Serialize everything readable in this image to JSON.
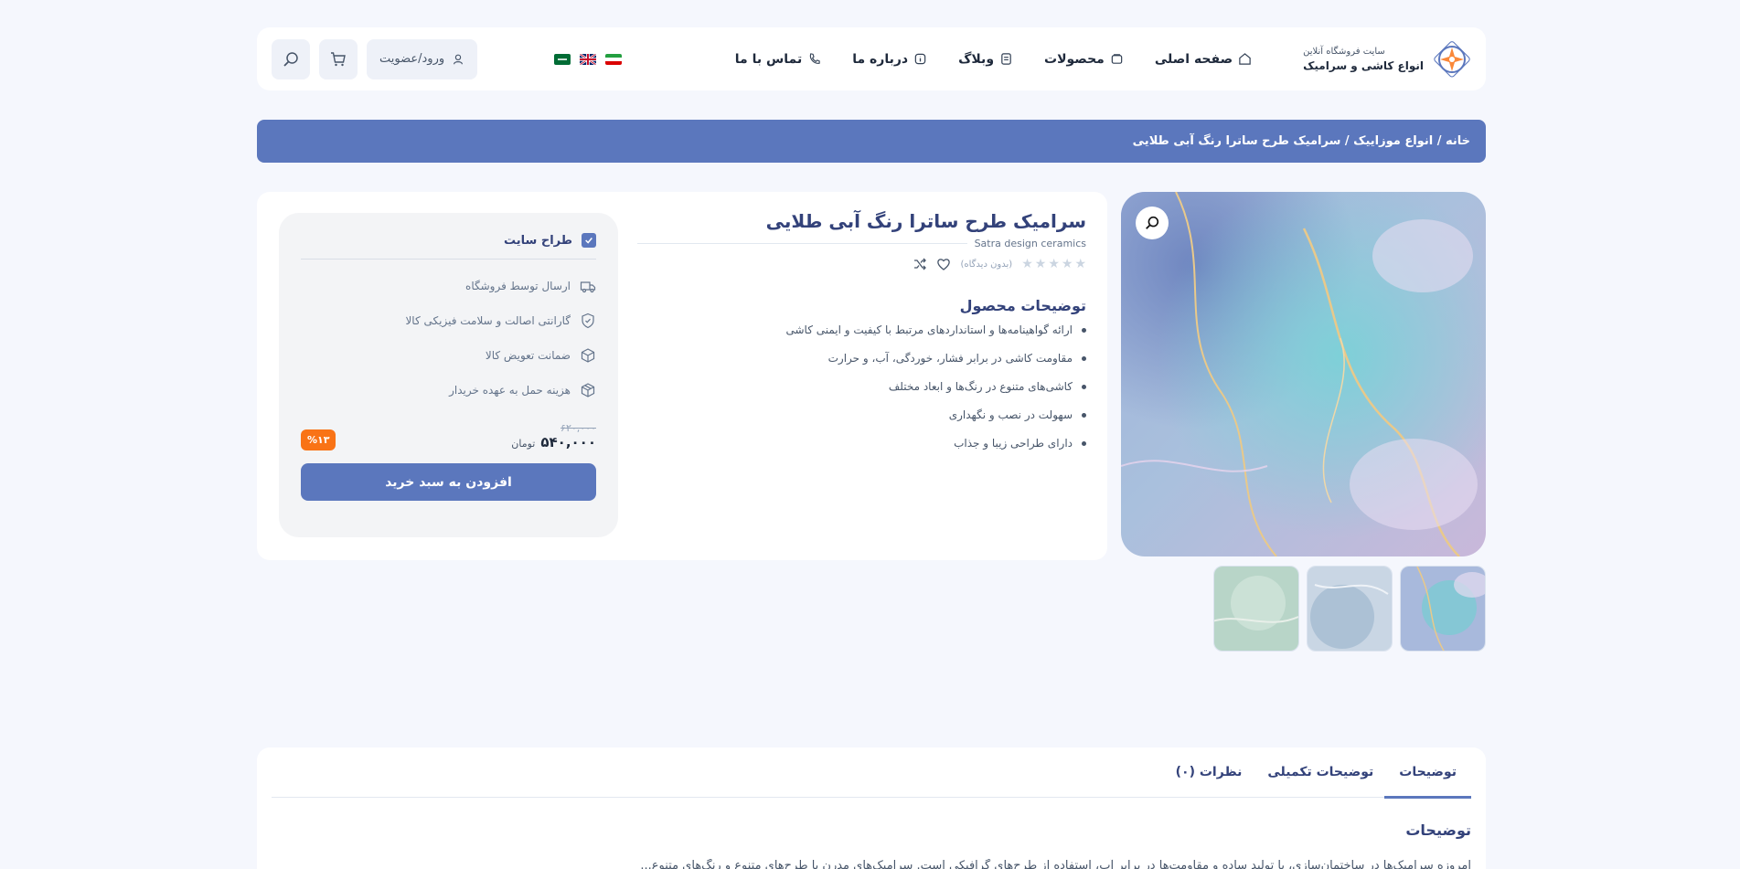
{
  "header": {
    "logo_small": "سایت فروشگاه آنلاین",
    "logo_big": "انواع کاشی و سرامیک",
    "nav": [
      {
        "label": "صفحه اصلی",
        "icon": "home-icon"
      },
      {
        "label": "محصولات",
        "icon": "products-icon"
      },
      {
        "label": "وبلاگ",
        "icon": "blog-icon"
      },
      {
        "label": "درباره ما",
        "icon": "info-icon"
      },
      {
        "label": "تماس با ما",
        "icon": "phone-icon"
      }
    ],
    "flags": [
      "flag-iran",
      "flag-uk",
      "flag-saudi"
    ],
    "login_label": "ورود/عضویت",
    "cart_icon": "cart-icon",
    "search_icon": "search-icon"
  },
  "breadcrumb": {
    "text": "خانه / انواع موزاییک / سرامیک طرح ساترا رنگ آبی طلایی"
  },
  "product": {
    "title": "سرامیک طرح ساترا رنگ آبی طلایی",
    "subtitle": "Satra design ceramics",
    "reviews": "(بدون دیدگاه)",
    "description_title": "توضیحات محصول",
    "features": [
      "ارائه گواهینامه‌ها و استانداردهای مرتبط با کیفیت و ایمنی کاشی",
      "مقاومت کاشی در برابر فشار، خوردگی، آب، و حرارت",
      "کاشی‌های متنوع در رنگ‌ها و ابعاد مختلف",
      "سهولت در نصب و نگهداری",
      "دارای طراحی زیبا و جذاب"
    ]
  },
  "buy_box": {
    "seller": "طراح سایت",
    "perks": [
      {
        "label": "ارسال توسط فروشگاه",
        "icon": "truck-icon"
      },
      {
        "label": "گارانتی اصالت و سلامت فیزیکی کالا",
        "icon": "shield-icon"
      },
      {
        "label": "ضمانت تعویض کالا",
        "icon": "box-exchange-icon"
      },
      {
        "label": "هزینه حمل به عهده خریدار",
        "icon": "package-icon"
      }
    ],
    "old_price": "۶۲۰,۰۰۰",
    "new_price": "۵۴۰,۰۰۰",
    "currency": "تومان",
    "discount": "%۱۳",
    "add_to_cart": "افزودن به سبد خرید"
  },
  "tabs": {
    "items": [
      "توضیحات",
      "توضیحات تکمیلی",
      "نظرات (۰)"
    ],
    "active": "توضیحات",
    "heading": "توضیحات",
    "text": "امروزه سرامیک‌ها در ساختمان‌سازی، یا تولید ساده و مقاومت‌ها در برابر آب، استفاده از طرح‌های گرافیکی است. سرامیک‌های مدرن با طرح‌های متنوع و رنگ‌های متنوع..."
  },
  "colors": {
    "primary": "#5b77bd",
    "title": "#33427a",
    "discount": "#f97316",
    "background": "#f5f7fd"
  }
}
